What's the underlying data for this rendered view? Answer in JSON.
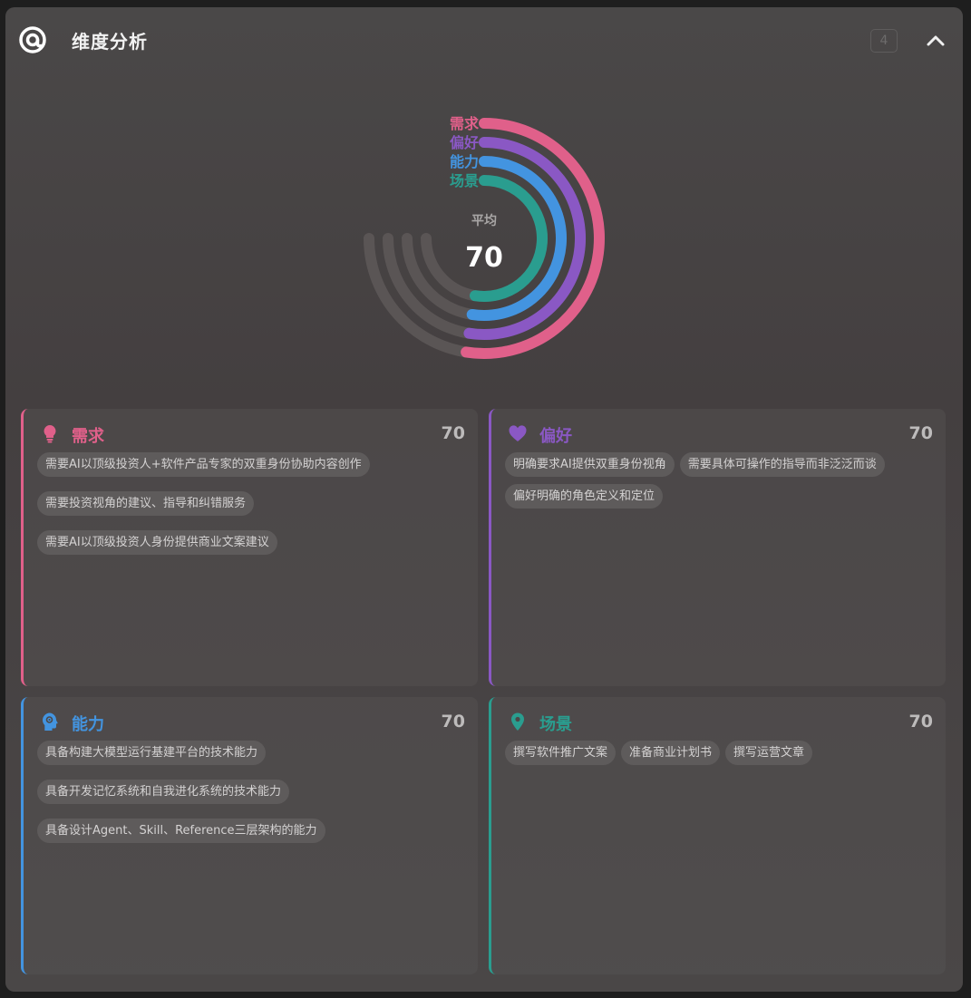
{
  "header": {
    "title": "维度分析",
    "count": "4"
  },
  "chart_data": {
    "type": "radial-bar",
    "center_label": "平均",
    "center_value": "70",
    "max": 100,
    "series": [
      {
        "name": "需求",
        "value": 70,
        "color": "#e0608a"
      },
      {
        "name": "偏好",
        "value": 70,
        "color": "#8a58c4"
      },
      {
        "name": "能力",
        "value": 70,
        "color": "#4394e0"
      },
      {
        "name": "场景",
        "value": 70,
        "color": "#2a9d8f"
      }
    ]
  },
  "cards": [
    {
      "title": "需求",
      "score": "70",
      "color": "#e0608a",
      "icon": "lightbulb-icon",
      "tags": [
        "需要AI以顶级投资人+软件产品专家的双重身份协助内容创作",
        "需要投资视角的建议、指导和纠错服务",
        "需要AI以顶级投资人身份提供商业文案建议"
      ]
    },
    {
      "title": "偏好",
      "score": "70",
      "color": "#8a58c4",
      "icon": "heart-icon",
      "tags": [
        "明确要求AI提供双重身份视角",
        "需要具体可操作的指导而非泛泛而谈",
        "偏好明确的角色定义和定位"
      ]
    },
    {
      "title": "能力",
      "score": "70",
      "color": "#4394e0",
      "icon": "brain-head-icon",
      "tags": [
        "具备构建大模型运行基建平台的技术能力",
        "具备开发记忆系统和自我进化系统的技术能力",
        "具备设计Agent、Skill、Reference三层架构的能力"
      ]
    },
    {
      "title": "场景",
      "score": "70",
      "color": "#2a9d8f",
      "icon": "map-pin-icon",
      "tags": [
        "撰写软件推广文案",
        "准备商业计划书",
        "撰写运营文章"
      ]
    }
  ]
}
